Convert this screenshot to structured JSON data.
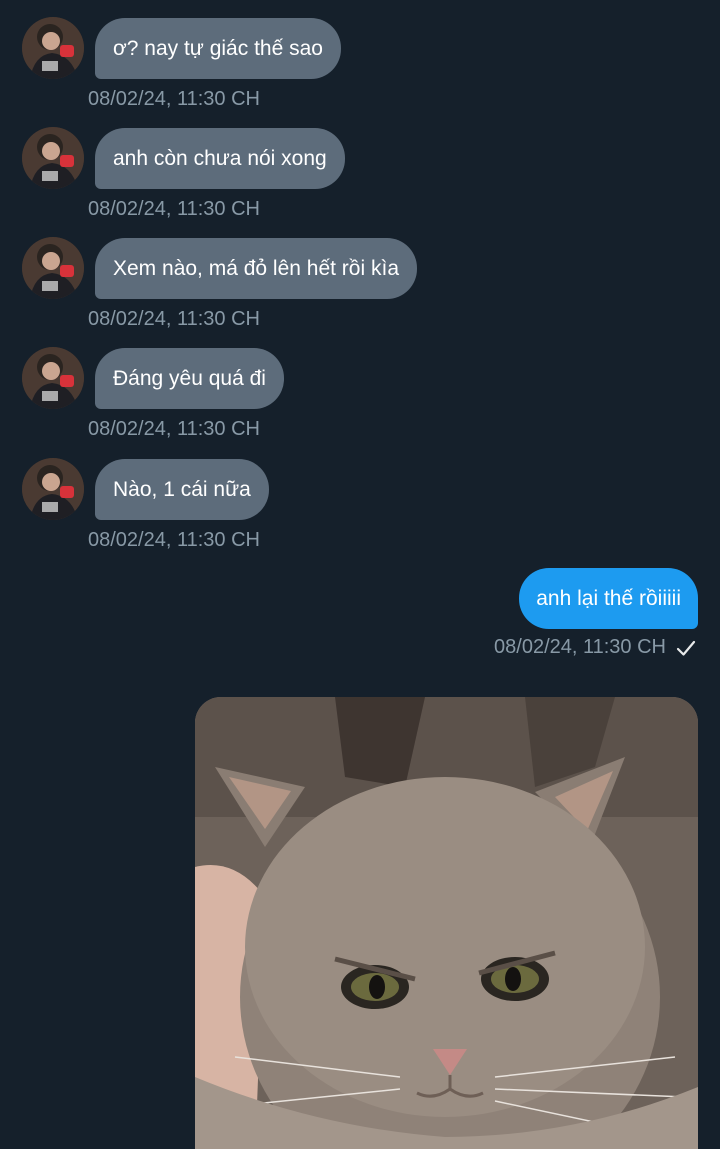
{
  "conversation": {
    "incoming": [
      {
        "text": "ơ? nay tự giác thế sao",
        "timestamp": "08/02/24, 11:30 CH"
      },
      {
        "text": "anh còn chưa nói xong",
        "timestamp": "08/02/24, 11:30 CH"
      },
      {
        "text": "Xem nào, má đỏ lên hết rồi kìa",
        "timestamp": "08/02/24, 11:30 CH"
      },
      {
        "text": "Đáng yêu quá đi",
        "timestamp": "08/02/24, 11:30 CH"
      },
      {
        "text": "Nào, 1 cái nữa",
        "timestamp": "08/02/24, 11:30 CH"
      }
    ],
    "outgoing": {
      "text": "anh lại thế rồiiiii",
      "timestamp": "08/02/24, 11:30 CH",
      "status_icon": "check-icon"
    },
    "attachment": {
      "type": "image",
      "subject": "grumpy-cat-photo"
    }
  },
  "colors": {
    "background": "#15202b",
    "incoming_bubble": "#5d6c7b",
    "outgoing_bubble": "#1d9bf0",
    "timestamp": "#8899a6",
    "text": "#ffffff"
  }
}
